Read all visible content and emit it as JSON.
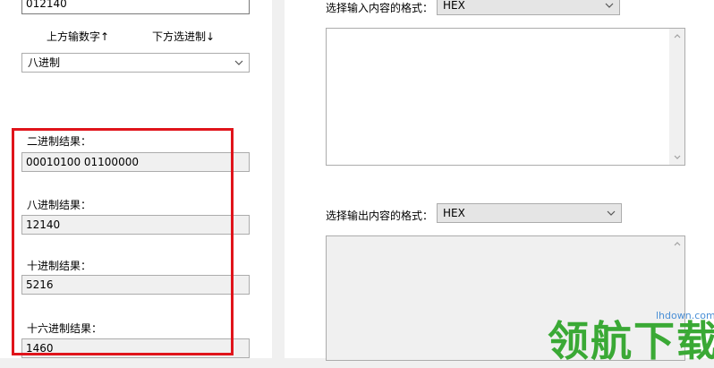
{
  "left": {
    "input_value": "012140",
    "up_label": "上方输数字↑",
    "down_label": "下方选进制↓",
    "base_select": "八进制",
    "results": [
      {
        "label": "二进制结果：",
        "value": "00010100 01100000"
      },
      {
        "label": "八进制结果：",
        "value": "12140"
      },
      {
        "label": "十进制结果：",
        "value": "5216"
      },
      {
        "label": "十六进制结果：",
        "value": "1460"
      }
    ]
  },
  "right": {
    "input_format_label": "选择输入内容的格式：",
    "input_format_value": "HEX",
    "output_format_label": "选择输出内容的格式：",
    "output_format_value": "HEX"
  },
  "watermark": {
    "text": "领航下载",
    "url": "lhdown.com"
  },
  "colors": {
    "highlight_box": "#e0141b",
    "watermark_green": "#3aa935"
  }
}
